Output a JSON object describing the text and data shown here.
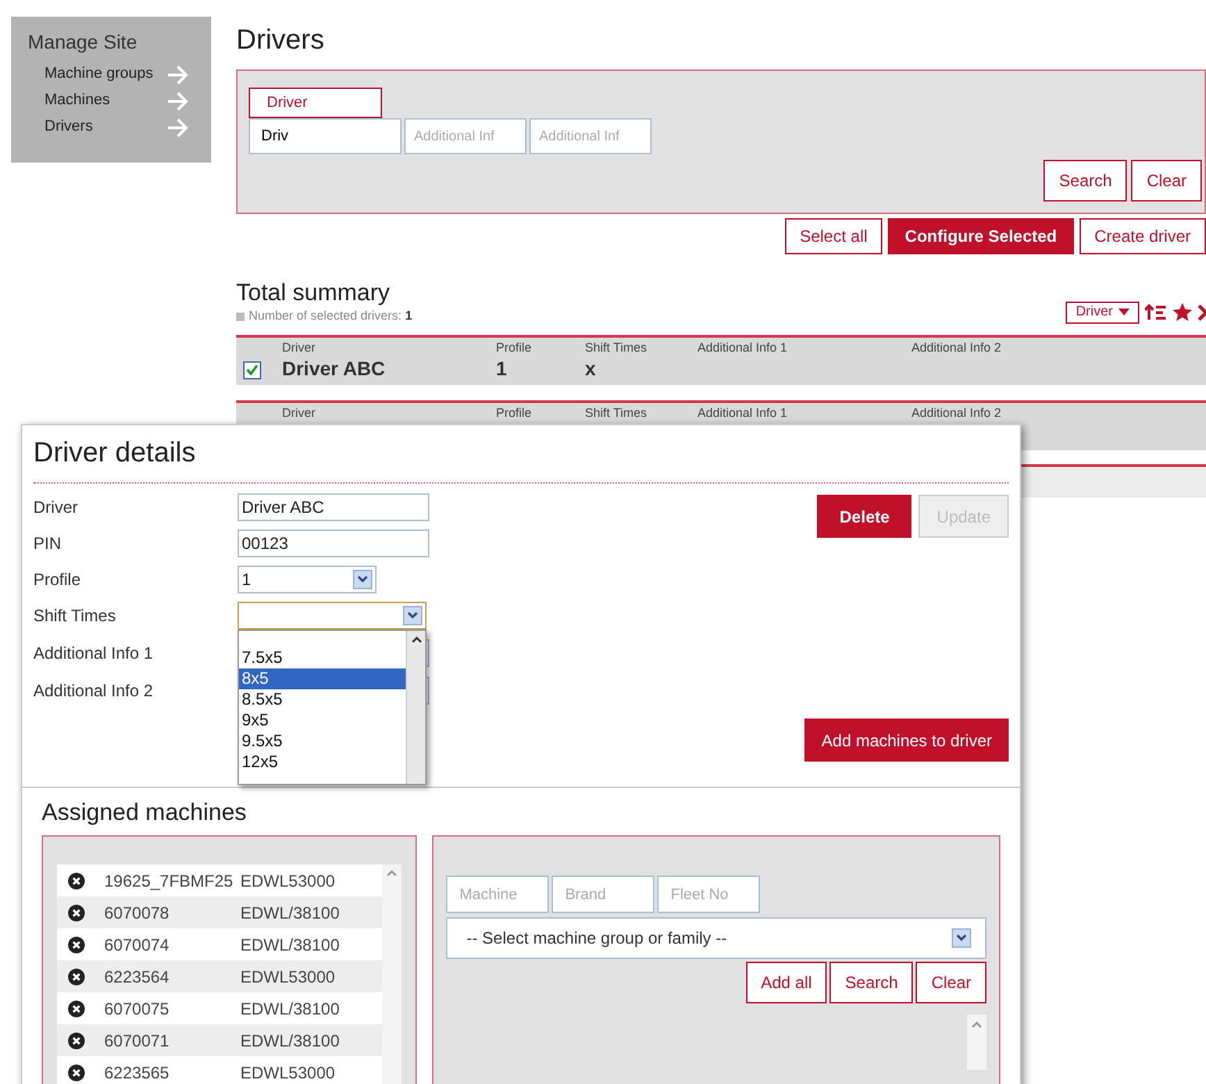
{
  "sidebar": {
    "title": "Manage Site",
    "items": [
      "Machine groups",
      "Machines",
      "Drivers"
    ]
  },
  "page": {
    "title": "Drivers"
  },
  "search": {
    "tab": "Driver",
    "value": "Driv",
    "placeholders": [
      "Additional Inf",
      "Additional Inf"
    ],
    "buttons": [
      "Search",
      "Clear"
    ]
  },
  "actions": [
    {
      "label": "Select all",
      "primary": false
    },
    {
      "label": "Configure Selected",
      "primary": true
    },
    {
      "label": "Create driver",
      "primary": false
    }
  ],
  "summary": {
    "title": "Total summary",
    "count_label": "Number of selected drivers:",
    "count": "1",
    "sort": "Driver"
  },
  "rows": [
    {
      "checked": true,
      "cells": [
        {
          "label": "Driver",
          "value": "Driver ABC"
        },
        {
          "label": "Profile",
          "value": "1"
        },
        {
          "label": "Shift Times",
          "value": "x"
        },
        {
          "label": "Additional Info 1"
        },
        {
          "label": "Additional Info 2"
        }
      ]
    },
    {
      "cells": [
        {
          "label": "Driver"
        },
        {
          "label": "Profile"
        },
        {
          "label": "Shift Times"
        },
        {
          "label": "Additional Info 1"
        },
        {
          "label": "Additional Info 2"
        }
      ]
    }
  ],
  "details": {
    "title": "Driver details",
    "fields": [
      {
        "kind": "text",
        "label": "Driver",
        "value": "Driver ABC"
      },
      {
        "kind": "text",
        "label": "PIN",
        "value": "00123"
      },
      {
        "kind": "select",
        "label": "Profile",
        "value": "1"
      },
      {
        "kind": "dropdown",
        "label": "Shift Times",
        "options": [
          {
            "label": "7.5x5",
            "selected": false
          },
          {
            "label": "8x5",
            "selected": true
          },
          {
            "label": "8.5x5",
            "selected": false
          },
          {
            "label": "9x5",
            "selected": false
          },
          {
            "label": "9.5x5",
            "selected": false
          },
          {
            "label": "12x5",
            "selected": false
          }
        ]
      },
      {
        "kind": "text",
        "label": "Additional Info 1"
      },
      {
        "kind": "text",
        "label": "Additional Info 2"
      }
    ],
    "buttons": [
      {
        "label": "Delete",
        "disabled": false
      },
      {
        "label": "Update",
        "disabled": true
      }
    ],
    "add_button": "Add machines to driver"
  },
  "assigned": {
    "title": "Assigned machines",
    "machines": [
      {
        "id": "19625_7FBMF25",
        "model": "EDWL53000"
      },
      {
        "id": "6070078",
        "model": "EDWL/38100"
      },
      {
        "id": "6070074",
        "model": "EDWL/38100"
      },
      {
        "id": "6223564",
        "model": "EDWL53000"
      },
      {
        "id": "6070075",
        "model": "EDWL/38100"
      },
      {
        "id": "6070071",
        "model": "EDWL/38100"
      },
      {
        "id": "6223565",
        "model": "EDWL53000"
      }
    ]
  },
  "finder": {
    "placeholders": [
      "Machine",
      "Brand",
      "Fleet No"
    ],
    "group_select": "-- Select machine group or family --",
    "buttons": [
      "Add all",
      "Search",
      "Clear"
    ]
  }
}
